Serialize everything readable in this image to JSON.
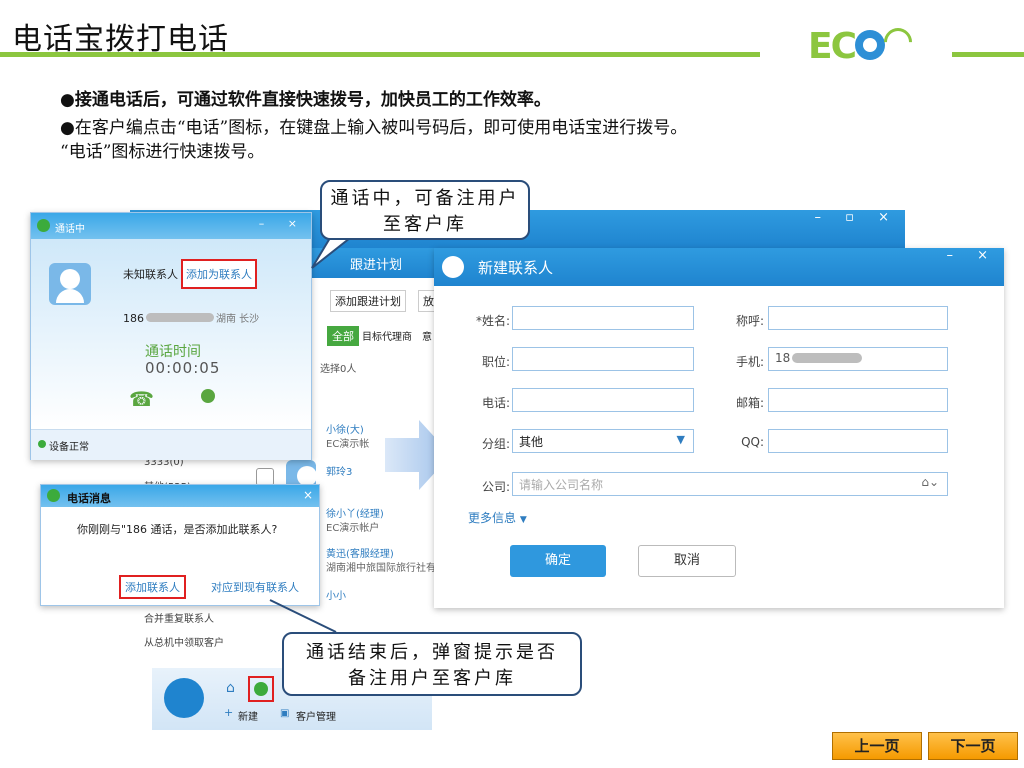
{
  "slide": {
    "title": "电话宝拨打电话",
    "logo_text": "EC",
    "bullet1": "●接通电话后，可通过软件直接快速拨号，加快员工的工作效率。",
    "bullet2": "●在客户编点击“电话”图标，在键盘上输入被叫号码后，即可使用电话宝进行拨号。",
    "bullet3": "“电话”图标进行快速拨号。"
  },
  "callouts": {
    "top": "通话中，可备注用户至客户库",
    "bottom": "通话结束后，弹窗提示是否备注用户至客户库"
  },
  "call_window": {
    "title": "通话中",
    "unknown": "未知联系人",
    "add_link": "添加为联系人",
    "number": "186",
    "location": "湖南 长沙",
    "time_label": "通话时间",
    "time": "00:00:05",
    "status": "设备正常"
  },
  "crm": {
    "tab_plan": "跟进计划",
    "btn_add_plan": "添加跟进计划",
    "btn_more": "放",
    "filter_all": "全部",
    "filter_agent": "目标代理商",
    "filter_more": "意",
    "selected": "选择0人",
    "group_3333": "3333(0)",
    "group_other": "其他(525)",
    "merge": "合并重复联系人",
    "claim": "从总机中领取客户",
    "contacts": [
      {
        "name": "小徐(大)",
        "company": "EC演示帐"
      },
      {
        "name": "郭玲3",
        "company": ""
      },
      {
        "name": "徐小丫(经理)",
        "company": "EC演示帐户"
      },
      {
        "name": "黄迅(客服经理)",
        "company": "湖南湘中旅国际旅行社有"
      },
      {
        "name": "小小",
        "company": ""
      }
    ],
    "bottom_new": "新建",
    "bottom_customer": "客户管理"
  },
  "new_contact": {
    "title": "新建联系人",
    "name_label": "*姓名:",
    "call_label": "称呼:",
    "position_label": "职位:",
    "mobile_label": "手机:",
    "mobile_value": "18",
    "phone_label": "电话:",
    "email_label": "邮箱:",
    "group_label": "分组:",
    "group_value": "其他",
    "qq_label": "QQ:",
    "company_label": "公司:",
    "company_placeholder": "请输入公司名称",
    "more_info": "更多信息",
    "ok": "确定",
    "cancel": "取消"
  },
  "popup": {
    "title": "电话消息",
    "message": "你刚刚与\"186 通话，是否添加此联系人?",
    "add": "添加联系人",
    "link_existing": "对应到现有联系人"
  },
  "nav": {
    "prev": "上一页",
    "next": "下一页"
  },
  "colors": {
    "accent_green": "#8cc63f",
    "ec_blue": "#1f84cf",
    "highlight_red": "#e02020",
    "nav_orange": "#f59a00"
  }
}
